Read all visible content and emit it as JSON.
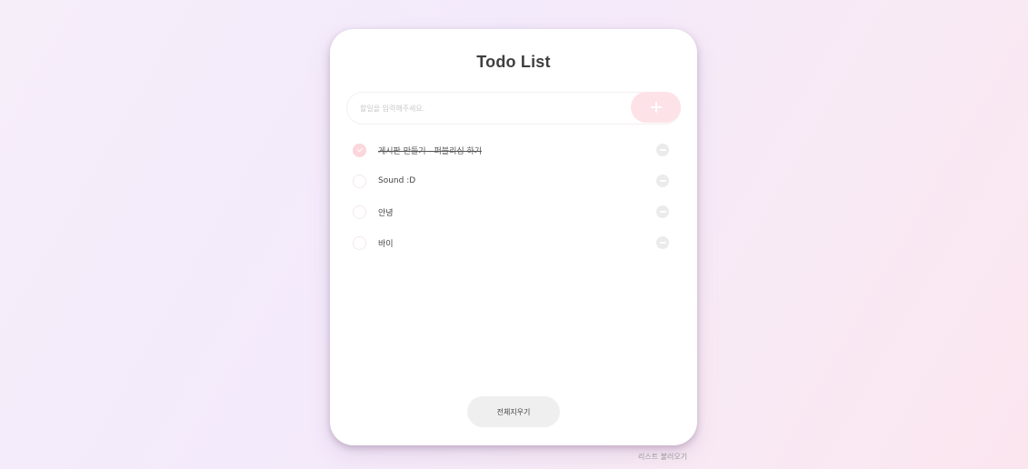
{
  "app": {
    "title": "Todo List"
  },
  "input": {
    "placeholder": "할일을 입력해주세요.",
    "value": ""
  },
  "add_button": {
    "icon": "plus-icon"
  },
  "todos": [
    {
      "text": "게시판 만들기 - 퍼블리싱 하기",
      "done": true
    },
    {
      "text": "Sound :D",
      "done": false
    },
    {
      "text": "안녕",
      "done": false
    },
    {
      "text": "바이",
      "done": false
    }
  ],
  "footer": {
    "clear_label": "전체지우기",
    "load_label": "리스트 불러오기"
  },
  "colors": {
    "accent_pink": "#fde3e7",
    "check_done": "#fbd6dc",
    "remove_icon": "#ebebeb",
    "clear_button": "#efeff0"
  }
}
